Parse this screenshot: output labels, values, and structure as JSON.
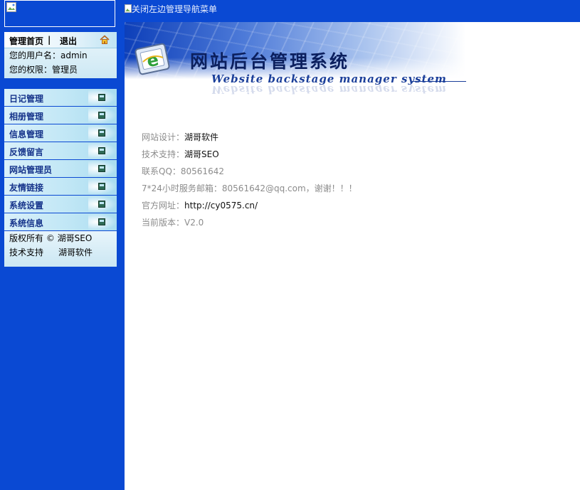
{
  "sidebar": {
    "user_panel": {
      "home_link": "管理首页",
      "separator": "|",
      "logout": "退出",
      "username_label": "您的用户名：",
      "username": "admin",
      "role_label": "您的权限：",
      "role": "管理员"
    },
    "menu": [
      {
        "label": "日记管理"
      },
      {
        "label": "相册管理"
      },
      {
        "label": "信息管理"
      },
      {
        "label": "反馈留言"
      },
      {
        "label": "网站管理员"
      },
      {
        "label": "友情链接"
      },
      {
        "label": "系统设置"
      },
      {
        "label": "系统信息"
      }
    ],
    "copyright": {
      "line1": "版权所有 © 湖哥SEO",
      "line2_label": "技术支持",
      "line2_value": "湖哥软件"
    }
  },
  "topbar": {
    "toggle_text": "关闭左边管理导航菜单"
  },
  "banner": {
    "title": "网站后台管理系统",
    "subtitle": "Website backstage manager system"
  },
  "info": {
    "design_label": "网站设计：",
    "design_value": "湖哥软件",
    "support_label": "技术支持：",
    "support_value": "湖哥SEO",
    "qq": "联系QQ：80561642",
    "email": "7*24小时服务邮箱：80561642@qq.com，谢谢！！！",
    "site_label": "官方网址：",
    "site_value": "http://cy0575.cn/",
    "version": "当前版本：V2.0"
  },
  "colors": {
    "sidebar_bg": "#0a49d3",
    "menu_text": "#15338a",
    "info_label": "#8c8c8c"
  }
}
